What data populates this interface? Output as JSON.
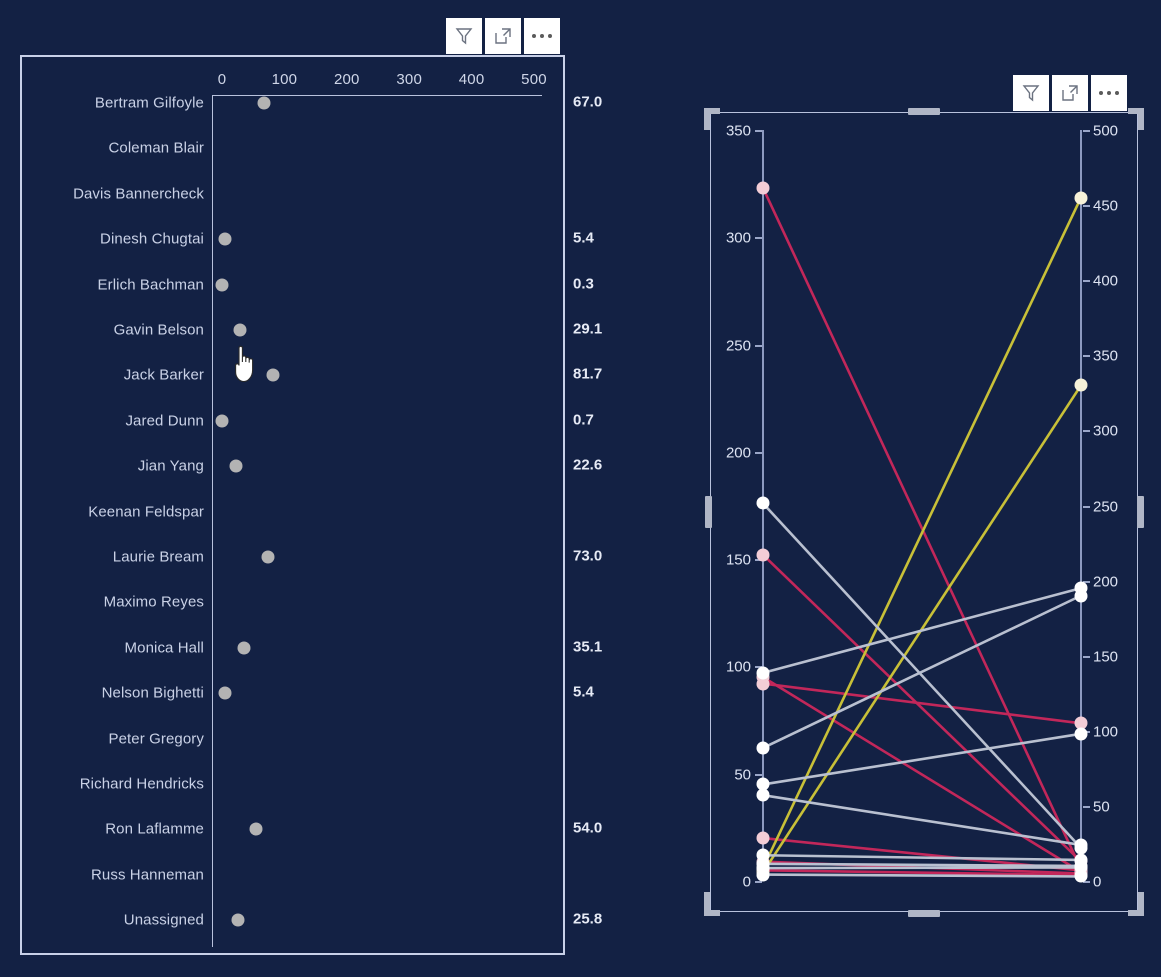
{
  "theme": {
    "background": "#132144",
    "panel_border": "#c8d0e8",
    "axis_color": "#b9c2dd",
    "text_color": "#c9d1e6",
    "value_text_color": "#e6eaf5",
    "dot_color": "#b3b3b3"
  },
  "toolbar": {
    "filter_label": "Filter",
    "focus_label": "Focus mode",
    "more_label": "More options",
    "icons": [
      "filter-funnel-icon",
      "focus-expand-icon",
      "more-ellipsis-icon"
    ]
  },
  "left_panel": {
    "name": "dot-plot-by-owner",
    "chart_data": {
      "type": "scatter",
      "title": "",
      "xlabel": "",
      "ylabel": "",
      "xlim": [
        0,
        540
      ],
      "xticks": [
        0,
        100,
        200,
        300,
        400,
        500
      ],
      "xtick_labels": [
        "0",
        "100",
        "200",
        "300",
        "400",
        "500"
      ],
      "grid": false,
      "legend": "none",
      "categories": [
        "Bertram Gilfoyle",
        "Coleman Blair",
        "Davis Bannercheck",
        "Dinesh Chugtai",
        "Erlich Bachman",
        "Gavin Belson",
        "Jack Barker",
        "Jared Dunn",
        "Jian Yang",
        "Keenan Feldspar",
        "Laurie Bream",
        "Maximo Reyes",
        "Monica Hall",
        "Nelson Bighetti",
        "Peter Gregory",
        "Richard Hendricks",
        "Ron Laflamme",
        "Russ Hanneman",
        "Unassigned"
      ],
      "points": [
        {
          "category": "Bertram Gilfoyle",
          "x": 67.0,
          "has_point": true,
          "right_label": "67.0"
        },
        {
          "category": "Coleman Blair",
          "x": null,
          "has_point": false,
          "right_label": ""
        },
        {
          "category": "Davis Bannercheck",
          "x": null,
          "has_point": false,
          "right_label": ""
        },
        {
          "category": "Dinesh Chugtai",
          "x": 5.4,
          "has_point": true,
          "right_label": "5.4"
        },
        {
          "category": "Erlich Bachman",
          "x": 0.3,
          "has_point": true,
          "right_label": "0.3"
        },
        {
          "category": "Gavin Belson",
          "x": 29.1,
          "has_point": true,
          "right_label": "29.1"
        },
        {
          "category": "Jack Barker",
          "x": 81.7,
          "has_point": true,
          "right_label": "81.7"
        },
        {
          "category": "Jared Dunn",
          "x": 0.7,
          "has_point": true,
          "right_label": "0.7"
        },
        {
          "category": "Jian Yang",
          "x": 22.6,
          "has_point": true,
          "right_label": "22.6"
        },
        {
          "category": "Keenan Feldspar",
          "x": null,
          "has_point": false,
          "right_label": ""
        },
        {
          "category": "Laurie Bream",
          "x": 73.0,
          "has_point": true,
          "right_label": "73.0"
        },
        {
          "category": "Maximo Reyes",
          "x": null,
          "has_point": false,
          "right_label": ""
        },
        {
          "category": "Monica Hall",
          "x": 35.1,
          "has_point": true,
          "right_label": "35.1"
        },
        {
          "category": "Nelson Bighetti",
          "x": 5.4,
          "has_point": true,
          "right_label": "5.4"
        },
        {
          "category": "Peter Gregory",
          "x": null,
          "has_point": false,
          "right_label": ""
        },
        {
          "category": "Richard Hendricks",
          "x": null,
          "has_point": false,
          "right_label": ""
        },
        {
          "category": "Ron Laflamme",
          "x": 54.0,
          "has_point": true,
          "right_label": "54.0"
        },
        {
          "category": "Russ Hanneman",
          "x": null,
          "has_point": false,
          "right_label": ""
        },
        {
          "category": "Unassigned",
          "x": 25.8,
          "has_point": true,
          "right_label": "25.8"
        }
      ]
    }
  },
  "right_panel": {
    "name": "parallel-coordinates-chart",
    "selected": true,
    "chart_data": {
      "type": "line",
      "subtype": "parallel-coordinates",
      "title": "",
      "grid": false,
      "legend": "none",
      "axes": [
        {
          "name": "left-axis",
          "position": "left",
          "ylim": [
            0,
            350
          ],
          "yticks": [
            0,
            50,
            100,
            150,
            200,
            250,
            300,
            350
          ],
          "ytick_labels": [
            "0",
            "50",
            "100",
            "150",
            "200",
            "250",
            "300",
            "350"
          ]
        },
        {
          "name": "right-axis",
          "position": "right",
          "ylim": [
            0,
            500
          ],
          "yticks": [
            0,
            50,
            100,
            150,
            200,
            250,
            300,
            350,
            400,
            450,
            500
          ],
          "ytick_labels": [
            "0",
            "50",
            "100",
            "150",
            "200",
            "250",
            "300",
            "350",
            "400",
            "450",
            "500"
          ]
        }
      ],
      "series": [
        {
          "name": "line-1",
          "color": "#c2275a",
          "left": 323,
          "right": 8
        },
        {
          "name": "line-2",
          "color": "#c2275a",
          "left": 152,
          "right": 13
        },
        {
          "name": "line-3",
          "color": "#c2275a",
          "left": 95,
          "right": 6
        },
        {
          "name": "line-4",
          "color": "#c2275a",
          "left": 92,
          "right": 105
        },
        {
          "name": "line-5",
          "color": "#c2275a",
          "left": 20,
          "right": 7
        },
        {
          "name": "line-6",
          "color": "#c2275a",
          "left": 9,
          "right": 5
        },
        {
          "name": "line-7",
          "color": "#c2275a",
          "left": 5,
          "right": 4
        },
        {
          "name": "line-8",
          "color": "#c8c038",
          "left": 6,
          "right": 455
        },
        {
          "name": "line-9",
          "color": "#c8c038",
          "left": 4,
          "right": 330
        },
        {
          "name": "line-10",
          "color": "#b9c0d0",
          "left": 176,
          "right": 22
        },
        {
          "name": "line-11",
          "color": "#b9c0d0",
          "left": 97,
          "right": 195
        },
        {
          "name": "line-12",
          "color": "#b9c0d0",
          "left": 62,
          "right": 190
        },
        {
          "name": "line-13",
          "color": "#b9c0d0",
          "left": 45,
          "right": 98
        },
        {
          "name": "line-14",
          "color": "#b9c0d0",
          "left": 40,
          "right": 24
        },
        {
          "name": "line-15",
          "color": "#b9c0d0",
          "left": 12,
          "right": 14
        },
        {
          "name": "line-16",
          "color": "#b9c0d0",
          "left": 8,
          "right": 10
        },
        {
          "name": "line-17",
          "color": "#b9c0d0",
          "left": 6,
          "right": 9
        },
        {
          "name": "line-18",
          "color": "#b9c0d0",
          "left": 3,
          "right": 3
        }
      ]
    }
  }
}
